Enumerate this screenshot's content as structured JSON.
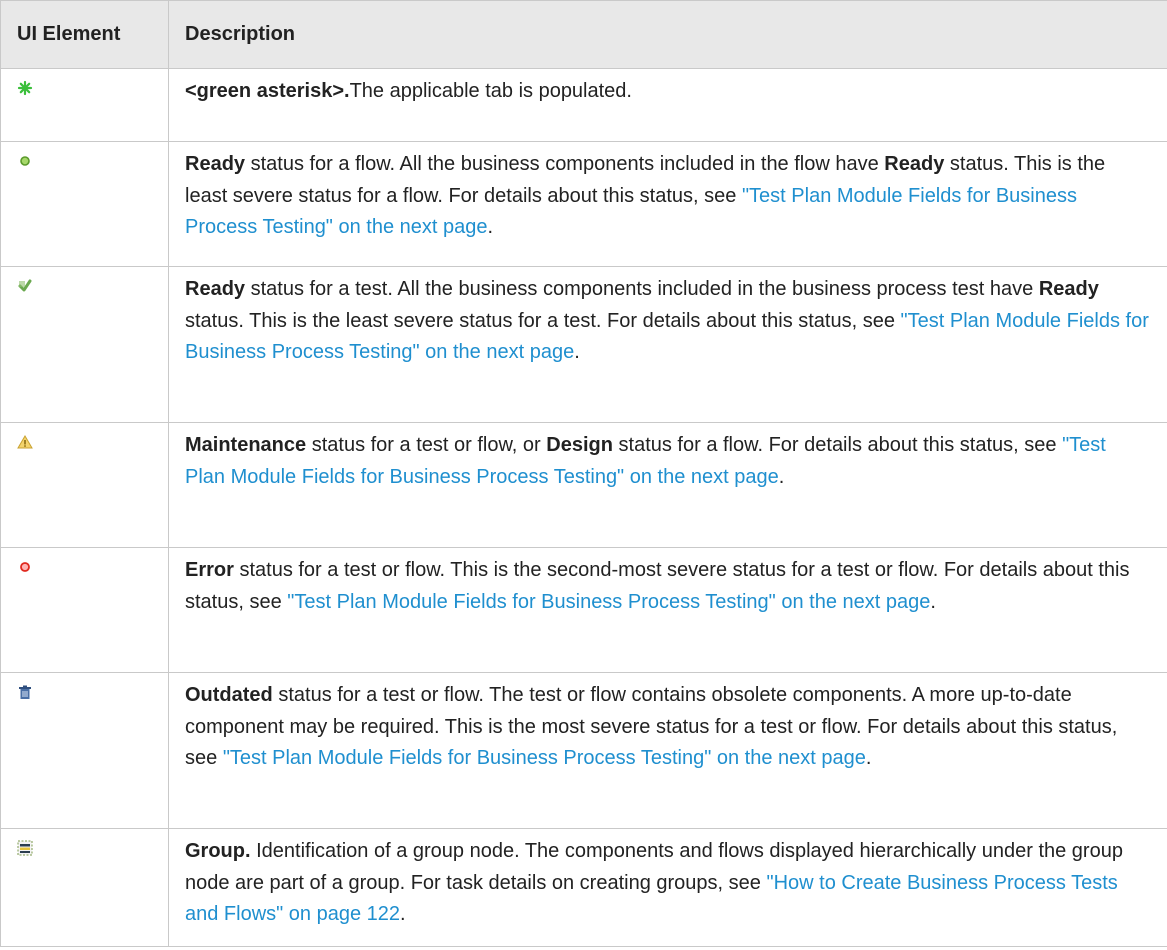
{
  "header": {
    "col_element": "UI Element",
    "col_description": "Description"
  },
  "rows": [
    {
      "icon": "green-asterisk-icon",
      "bold": "<green asterisk>.",
      "text": "The applicable tab is populated."
    },
    {
      "icon": "ready-flow-icon",
      "bold": "Ready",
      "text_a": " status for a flow. All the business components included in the flow have ",
      "bold2": "Ready",
      "text_b": " status. This is the least severe status for a flow. For details about this status, see ",
      "link": "\"Test Plan Module Fields for Business Process Testing\" on the next page",
      "end": "."
    },
    {
      "icon": "ready-test-icon",
      "bold": "Ready",
      "text_a": " status for a test. All the business components included in the business process test have ",
      "bold2": "Ready",
      "text_b": " status. This is the least severe status for a test. For details about this status, see ",
      "link": "\"Test Plan Module Fields for Business Process Testing\" on the next page",
      "end": "."
    },
    {
      "icon": "maintenance-icon",
      "bold": "Maintenance",
      "text_a": "  status for a test or flow, or ",
      "bold2": "Design",
      "text_b": " status for a flow. For details about this status, see ",
      "link": "\"Test Plan Module Fields for Business Process Testing\" on the next page",
      "end": "."
    },
    {
      "icon": "error-icon",
      "bold": "Error",
      "text": " status for a test or flow. This is the second-most severe status for a test or flow. For details about this status, see ",
      "link": "\"Test Plan Module Fields for Business Process Testing\" on the next page",
      "end": "."
    },
    {
      "icon": "outdated-trash-icon",
      "bold": "Outdated",
      "text": " status for a test or flow. The test or flow contains obsolete components. A more up-to-date component may be required. This is the most severe status for a test or flow. For details about this status, see ",
      "link": "\"Test Plan Module Fields for Business Process Testing\" on the next page",
      "end": "."
    },
    {
      "icon": "group-icon",
      "bold": "Group.",
      "text": " Identification of a group node. The components and flows displayed hierarchically under the group node are part of a group. For task details on creating groups, see ",
      "link": "\"How to Create Business Process Tests and Flows\" on page 122",
      "end": "."
    }
  ],
  "colors": {
    "link": "#1f8fcf",
    "header_bg": "#e8e8e8",
    "border": "#c9c9c9"
  }
}
